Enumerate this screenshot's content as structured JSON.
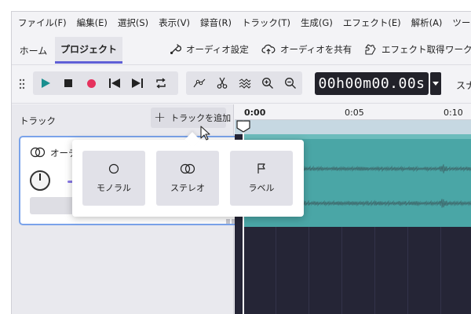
{
  "menubar": {
    "items": [
      "ファイル(F)",
      "編集(E)",
      "選択(S)",
      "表示(V)",
      "録音(R)",
      "トラック(T)",
      "生成(G)",
      "エフェクト(E)",
      "解析(A)",
      "ツール(T)"
    ]
  },
  "tabs": {
    "home": "ホーム",
    "project": "プロジェクト"
  },
  "toolbar": {
    "audio_settings": "オーディオ設定",
    "share_audio": "オーディオを共有",
    "get_effects": "エフェクト取得",
    "workspace": "ワークス"
  },
  "transport": {
    "timecode": "00h00m00.00s",
    "snap_label": "スナ"
  },
  "track_panel": {
    "title": "トラック",
    "add_track": "トラックを追加",
    "track_name": "オーディ"
  },
  "ruler": {
    "labels": [
      "0:00",
      "0:05",
      "0:10"
    ]
  },
  "add_track_popup": {
    "mono": "モノラル",
    "stereo": "ステレオ",
    "label": "ラベル"
  },
  "colors": {
    "accent": "#5f5fd6",
    "clip": "#4aa6a6",
    "timeline_bg": "#252536",
    "record": "#e5325d",
    "play": "#1a8f8f"
  }
}
